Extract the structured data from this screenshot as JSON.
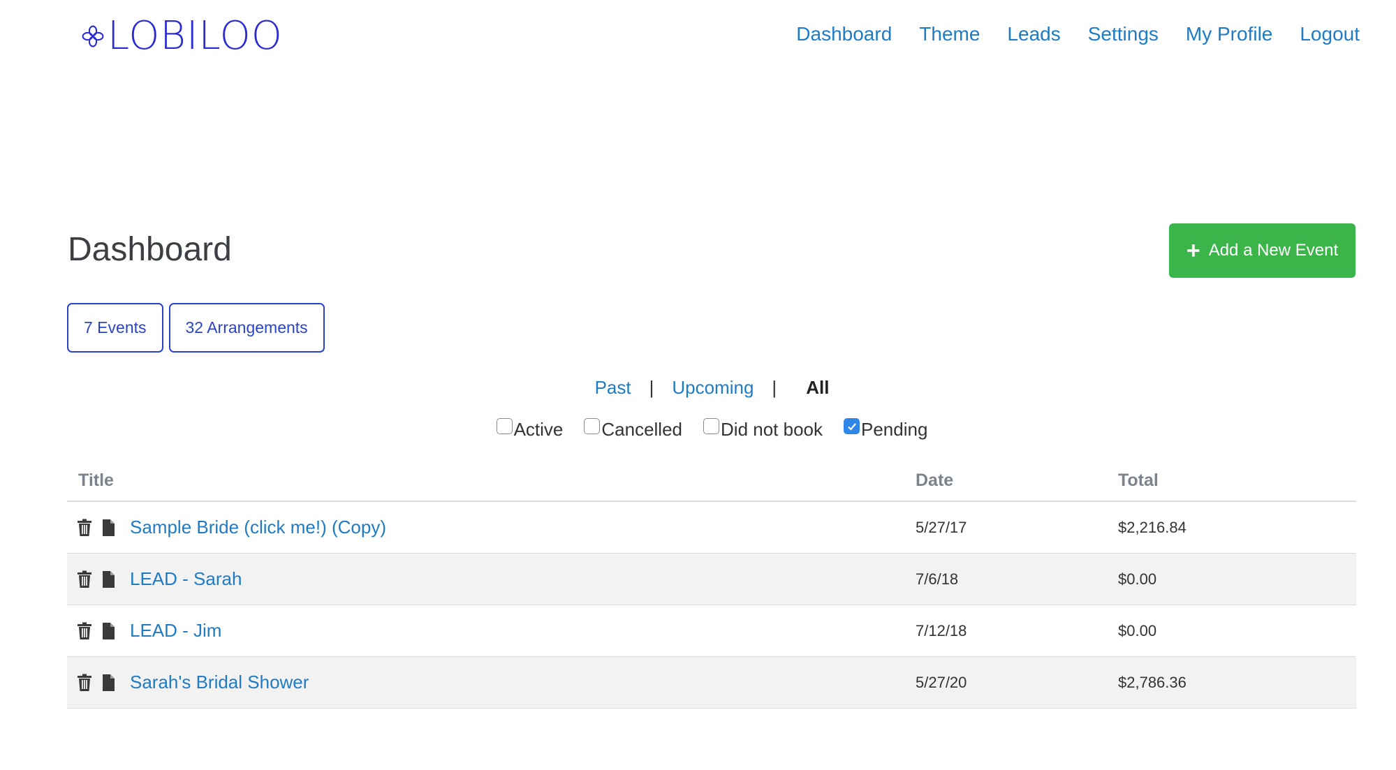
{
  "brand": {
    "name": "LOBILOO"
  },
  "nav": {
    "items": [
      "Dashboard",
      "Theme",
      "Leads",
      "Settings",
      "My Profile",
      "Logout"
    ]
  },
  "page": {
    "title": "Dashboard",
    "add_button_label": "Add a New Event",
    "add_button_color": "#3bb54a"
  },
  "chips": [
    "7 Events",
    "32 Arrangements"
  ],
  "time_filter": {
    "past": "Past",
    "upcoming": "Upcoming",
    "all": "All",
    "separator": "|"
  },
  "status_filter": [
    {
      "label": "Active",
      "checked": false
    },
    {
      "label": "Cancelled",
      "checked": false
    },
    {
      "label": "Did not book",
      "checked": false
    },
    {
      "label": "Pending",
      "checked": true
    }
  ],
  "table": {
    "headers": {
      "title": "Title",
      "date": "Date",
      "total": "Total"
    },
    "rows": [
      {
        "title": "Sample Bride (click me!) (Copy)",
        "date": "5/27/17",
        "total": "$2,216.84"
      },
      {
        "title": "LEAD - Sarah",
        "date": "7/6/18",
        "total": "$0.00"
      },
      {
        "title": "LEAD - Jim",
        "date": "7/12/18",
        "total": "$0.00"
      },
      {
        "title": "Sarah's Bridal Shower",
        "date": "5/27/20",
        "total": "$2,786.36"
      }
    ]
  },
  "colors": {
    "link": "#1e7bc4",
    "brand": "#2b2bd6",
    "chip": "#2a43c9",
    "checkbox": "#2f86e8"
  }
}
